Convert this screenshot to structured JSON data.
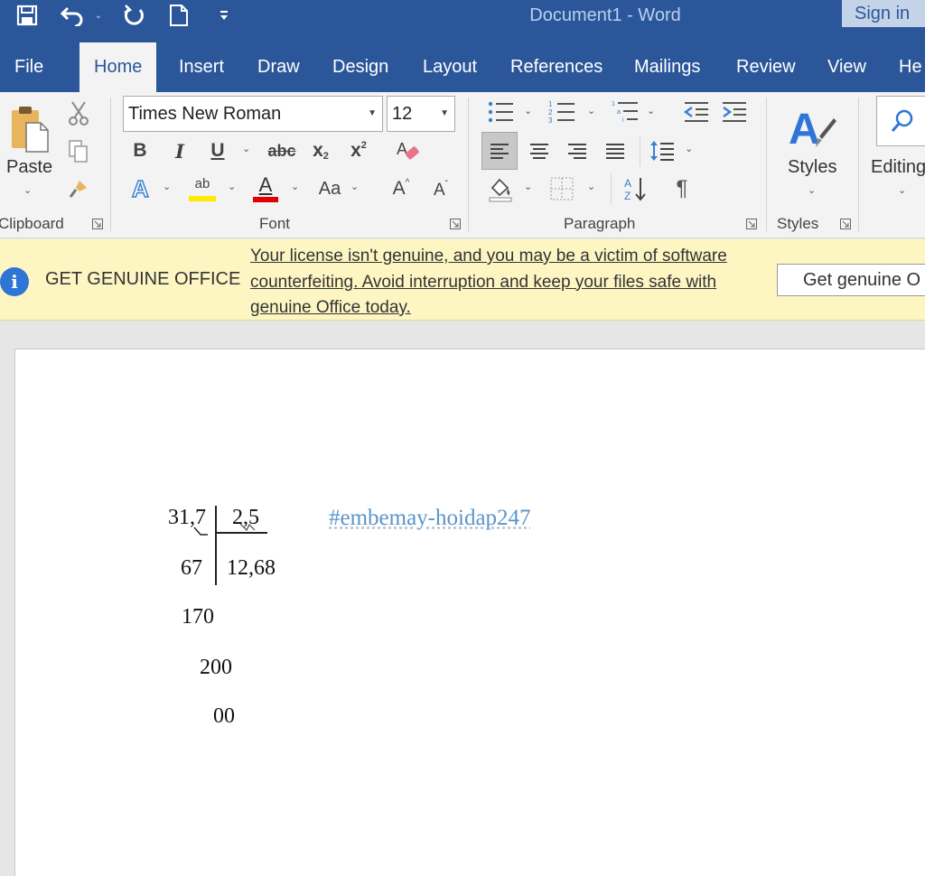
{
  "title_bar": {
    "document_title": "Document1  -  Word",
    "sign_in_label": "Sign in",
    "qat_icons": [
      "save-icon",
      "undo-icon",
      "redo-icon",
      "new-document-icon",
      "customize-qat-icon"
    ]
  },
  "tabs": [
    {
      "label": "File"
    },
    {
      "label": "Home",
      "active": true
    },
    {
      "label": "Insert"
    },
    {
      "label": "Draw"
    },
    {
      "label": "Design"
    },
    {
      "label": "Layout"
    },
    {
      "label": "References"
    },
    {
      "label": "Mailings"
    },
    {
      "label": "Review"
    },
    {
      "label": "View"
    },
    {
      "label": "He"
    }
  ],
  "ribbon": {
    "clipboard": {
      "label": "Clipboard",
      "paste_label": "Paste"
    },
    "font": {
      "label": "Font",
      "font_name": "Times New Roman",
      "font_size": "12",
      "bold": "B",
      "italic": "I",
      "underline": "U",
      "strikethrough": "abc",
      "subscript": "x",
      "subscript_mark": "2",
      "superscript": "x",
      "superscript_mark": "2",
      "change_case": "Aa",
      "grow_font": "A",
      "shrink_font": "A",
      "highlight_text": "ab",
      "font_color_letter": "A",
      "highlight_color": "#ffeb00",
      "font_color": "#e00000"
    },
    "paragraph": {
      "label": "Paragraph",
      "show_marks": "¶"
    },
    "styles": {
      "label": "Styles",
      "button_label": "Styles"
    },
    "editing": {
      "button_label": "Editing"
    }
  },
  "notification": {
    "title": "GET GENUINE OFFICE",
    "message": "Your license isn't genuine, and you may be a victim of software counterfeiting. Avoid interruption and keep your files safe with genuine Office today.",
    "button_label": "Get genuine O"
  },
  "document": {
    "division": {
      "dividend": "31,7",
      "divisor": "2,5",
      "quotient": "12,68",
      "steps": [
        "67",
        "170",
        "200",
        "00"
      ]
    },
    "watermark": "#embemay-hoidap247"
  },
  "colors": {
    "title_bar": "#2b579a",
    "ribbon_bg": "#f3f3f3",
    "info_bar": "#fdf6c3",
    "watermark": "#5b95c9"
  }
}
